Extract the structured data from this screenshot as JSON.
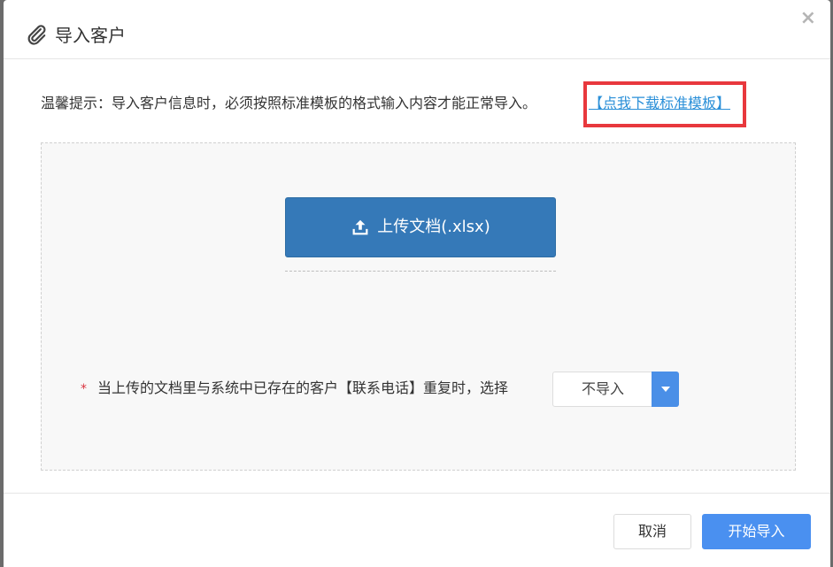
{
  "dialog": {
    "title": "导入客户",
    "title_icon": "paperclip-icon",
    "close_label": "×"
  },
  "tip": {
    "text": "温馨提示：导入客户信息时，必须按照标准模板的格式输入内容才能正常导入。",
    "link_label": "【点我下载标准模板】"
  },
  "upload": {
    "button_label": "上传文档(.xlsx)",
    "icon": "upload-icon"
  },
  "duplicate": {
    "required_mark": "*",
    "label": "当上传的文档里与系统中已存在的客户【联系电话】重复时，选择",
    "selected": "不导入"
  },
  "footer": {
    "cancel_label": "取消",
    "start_label": "开始导入"
  },
  "colors": {
    "primary": "#3579b8",
    "accent": "#4a90f0",
    "link": "#2a8fd8",
    "highlight": "#e8383d"
  }
}
